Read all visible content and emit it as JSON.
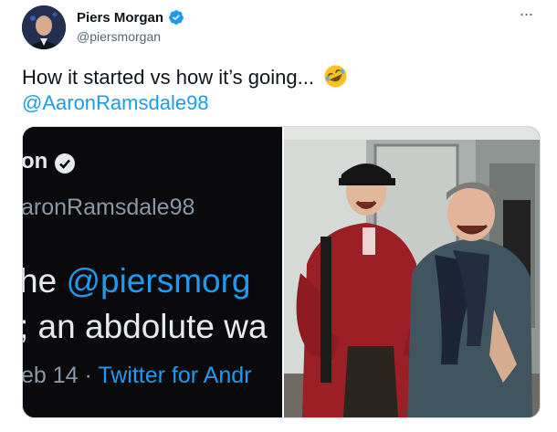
{
  "author": {
    "name": "Piers Morgan",
    "handle": "@piersmorgan"
  },
  "tweet": {
    "text": "How it started vs how it’s going...",
    "emoji": "rolling-on-floor-laughing-emoji",
    "mention": "@AaronRamsdale98"
  },
  "media": {
    "left_screenshot": {
      "name_fragment": "on",
      "handle_fragment": "aronRamsdale98",
      "line1_prefix": "he ",
      "line1_mention": "@piersmorg",
      "line2": "; an abdolute wa",
      "date_fragment": "eb 14",
      "separator": "·",
      "source_fragment": "Twitter for Andr"
    },
    "right_photo": {
      "description_icon": "photo-two-men-laughing"
    }
  },
  "colors": {
    "link": "#1d9bf0",
    "verified": "#1d9bf0",
    "dark_bg": "#0a0a0d",
    "handle_gray": "#536471"
  }
}
